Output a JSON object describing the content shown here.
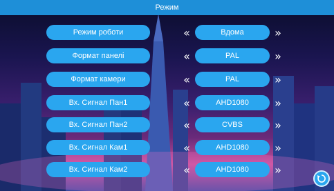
{
  "header": {
    "title": "Режим"
  },
  "rows": [
    {
      "label": "Режим роботи",
      "value": "Вдома"
    },
    {
      "label": "Формат панелі",
      "value": "PAL"
    },
    {
      "label": "Формат камери",
      "value": "PAL"
    },
    {
      "label": "Вх. Сигнал Пан1",
      "value": "AHD1080"
    },
    {
      "label": "Вх. Сигнал Пан2",
      "value": "CVBS"
    },
    {
      "label": "Вх. Сигнал Кам1",
      "value": "AHD1080"
    },
    {
      "label": "Вх. Сигнал Кам2",
      "value": "AHD1080"
    }
  ],
  "arrows": {
    "prev": "«",
    "next": "»"
  },
  "colors": {
    "accent": "#2aa6ef",
    "titlebar": "#1e8fd8"
  },
  "icons": {
    "back": "back-arrow-icon"
  }
}
